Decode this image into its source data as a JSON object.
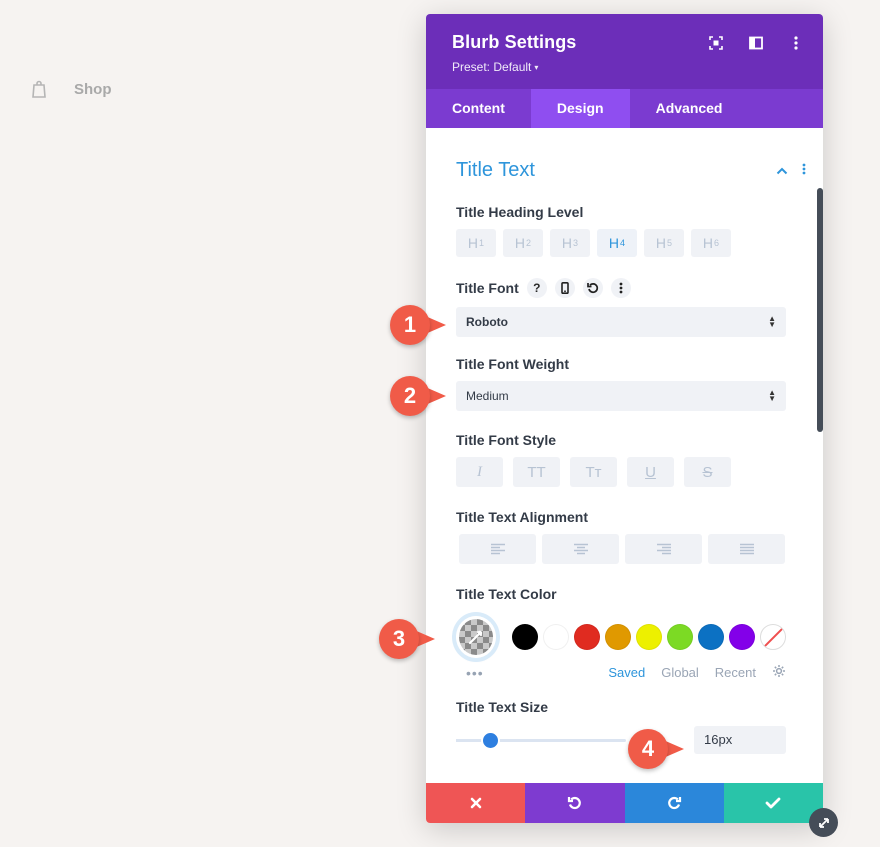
{
  "background": {
    "shop_label": "Shop"
  },
  "modal": {
    "title": "Blurb Settings",
    "preset": "Preset: Default",
    "preset_caret": "▾",
    "tabs": [
      {
        "label": "Content",
        "active": false
      },
      {
        "label": "Design",
        "active": true
      },
      {
        "label": "Advanced",
        "active": false
      }
    ]
  },
  "section": {
    "title": "Title Text"
  },
  "heading_level": {
    "label": "Title Heading Level",
    "options": [
      "H1",
      "H2",
      "H3",
      "H4",
      "H5",
      "H6"
    ],
    "selected": "H4"
  },
  "font": {
    "label": "Title Font",
    "help_icon": "?",
    "value": "Roboto"
  },
  "font_weight": {
    "label": "Title Font Weight",
    "value": "Medium"
  },
  "font_style": {
    "label": "Title Font Style",
    "options": [
      "I",
      "TT",
      "Tт",
      "U",
      "S"
    ]
  },
  "alignment": {
    "label": "Title Text Alignment",
    "options": [
      "left",
      "center",
      "right",
      "justify"
    ]
  },
  "text_color": {
    "label": "Title Text Color",
    "swatches": [
      "#000000",
      "#ffffff",
      "#e02b20",
      "#e09900",
      "#edf000",
      "#7cda24",
      "#0c71c3",
      "#8300e9"
    ],
    "footer_more": "•••",
    "tab_saved": "Saved",
    "tab_global": "Global",
    "tab_recent": "Recent"
  },
  "text_size": {
    "label": "Title Text Size",
    "value": "16px",
    "slider_fraction": 0.2
  },
  "callouts": [
    "1",
    "2",
    "3",
    "4"
  ],
  "colors": {
    "header_bg": "#6c2eb9",
    "tabs_bg": "#7b3bd0",
    "active_tab": "#8f4ef0",
    "accent": "#2e95db",
    "cancel": "#ef5555",
    "undo": "#7e3bd0",
    "redo": "#2b87da",
    "save": "#29c4a9",
    "callout": "#f05b48"
  }
}
